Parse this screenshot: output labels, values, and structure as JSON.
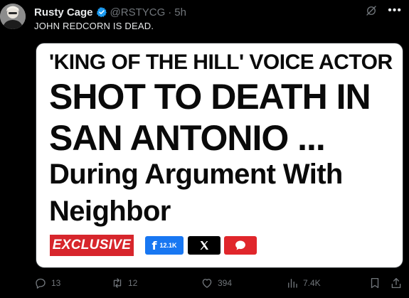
{
  "author": {
    "name": "Rusty Cage",
    "handle": "@RSTYCG",
    "separator": "·",
    "time": "5h",
    "verified_color": "#1d9bf0"
  },
  "tweet": {
    "text": "JOHN REDCORN IS DEAD."
  },
  "card": {
    "line1": "'KING OF THE HILL' VOICE ACTOR",
    "line2": "SHOT TO DEATH IN",
    "line3": "SAN ANTONIO ...",
    "line4": "During Argument With",
    "line5": "Neighbor",
    "badge": "EXCLUSIVE",
    "badge_color": "#d7262c",
    "facebook_letter": "f",
    "facebook_count": "12.1K"
  },
  "stats": {
    "replies": "13",
    "retweets": "12",
    "likes": "394",
    "views": "7.4K"
  },
  "icons": {
    "header": [
      "grok-icon",
      "more-icon"
    ],
    "actions": [
      "reply-icon",
      "retweet-icon",
      "like-icon",
      "views-icon",
      "bookmark-icon",
      "share-icon"
    ]
  }
}
